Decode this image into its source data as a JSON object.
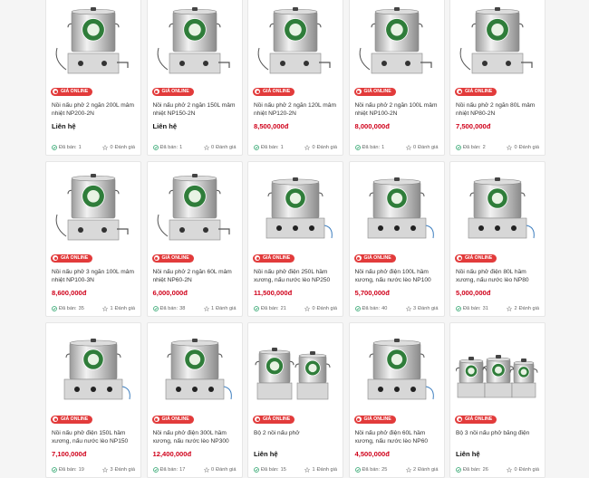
{
  "badge_label": "GIÁ ONLINE",
  "sold_prefix": "Đã bán:",
  "rating_suffix": "Đánh giá",
  "accent_color": "#d0021b",
  "badge_color": "#e23b3b",
  "products": [
    {
      "name": "Nồi nấu phở 2 ngăn 200L mâm nhiệt NP200-2N",
      "price": "Liên hệ",
      "sold": "1",
      "rating": "0",
      "image": "pot-single-tall"
    },
    {
      "name": "Nồi nấu phở 2 ngăn 150L mâm nhiệt NP150-2N",
      "price": "Liên hệ",
      "sold": "1",
      "rating": "0",
      "image": "pot-single-tall"
    },
    {
      "name": "Nồi nấu phở 2 ngăn 120L mâm nhiệt NP120-2N",
      "price": "8,500,000đ",
      "sold": "1",
      "rating": "0",
      "image": "pot-single-tall"
    },
    {
      "name": "Nồi nấu phở 2 ngăn 100L mâm nhiệt NP100-2N",
      "price": "8,000,000đ",
      "sold": "1",
      "rating": "0",
      "image": "pot-single-tall"
    },
    {
      "name": "Nồi nấu phở 2 ngăn 80L mâm nhiệt NP80-2N",
      "price": "7,500,000đ",
      "sold": "2",
      "rating": "0",
      "image": "pot-single-tall"
    },
    {
      "name": "Nồi nấu phở 3 ngăn 100L mâm nhiệt NP100-3N",
      "price": "8,600,000đ",
      "sold": "35",
      "rating": "1",
      "image": "pot-single-tall"
    },
    {
      "name": "Nồi nấu phở 2 ngăn 60L mâm nhiệt NP60-2N",
      "price": "6,000,000đ",
      "sold": "38",
      "rating": "1",
      "image": "pot-single-tall"
    },
    {
      "name": "Nồi nấu phở điện 250L hầm xương, nấu nước lèo NP250",
      "price": "11,500,000đ",
      "sold": "21",
      "rating": "0",
      "image": "pot-wide"
    },
    {
      "name": "Nồi nấu phở điện 100L hầm xương, nấu nước lèo NP100",
      "price": "5,700,000đ",
      "sold": "40",
      "rating": "3",
      "image": "pot-wide"
    },
    {
      "name": "Nồi nấu phở điện 80L hầm xương, nấu nước lèo NP80",
      "price": "5,000,000đ",
      "sold": "31",
      "rating": "2",
      "image": "pot-wide"
    },
    {
      "name": "Nồi nấu phở điện 150L hầm xương, nấu nước lèo NP150",
      "price": "7,100,000đ",
      "sold": "19",
      "rating": "3",
      "image": "pot-wide"
    },
    {
      "name": "Nồi nấu phở điện 300L hầm xương, nấu nước lèo NP300",
      "price": "12,400,000đ",
      "sold": "17",
      "rating": "0",
      "image": "pot-wide"
    },
    {
      "name": "Bộ 2 nồi nấu phở",
      "price": "Liên hệ",
      "sold": "15",
      "rating": "1",
      "image": "pot-pair"
    },
    {
      "name": "Nồi nấu phở điện 60L hầm xương, nấu nước lèo NP60",
      "price": "4,500,000đ",
      "sold": "25",
      "rating": "2",
      "image": "pot-wide"
    },
    {
      "name": "Bộ 3 nồi nấu phở bằng điện",
      "price": "Liên hệ",
      "sold": "26",
      "rating": "0",
      "image": "pot-trio"
    }
  ]
}
